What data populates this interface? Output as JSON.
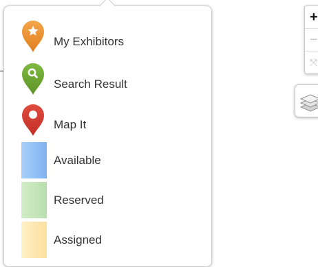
{
  "legend": {
    "items": [
      {
        "label": "My Exhibitors",
        "icon": "star-pin-icon",
        "color": "#e98f2f"
      },
      {
        "label": "Search Result",
        "icon": "search-pin-icon",
        "color": "#6da533"
      },
      {
        "label": "Map It",
        "icon": "location-pin-icon",
        "color": "#d33a2f"
      },
      {
        "label": "Available",
        "swatch_color": "#8cbdf5"
      },
      {
        "label": "Reserved",
        "swatch_color": "#c3e5b7"
      },
      {
        "label": "Assigned",
        "swatch_color": "#fde7b2"
      }
    ]
  },
  "map_controls": {
    "zoom_in_label": "+",
    "zoom_out_label": "−",
    "fullscreen_label": "⤧",
    "layers_icon": "layers-icon"
  }
}
